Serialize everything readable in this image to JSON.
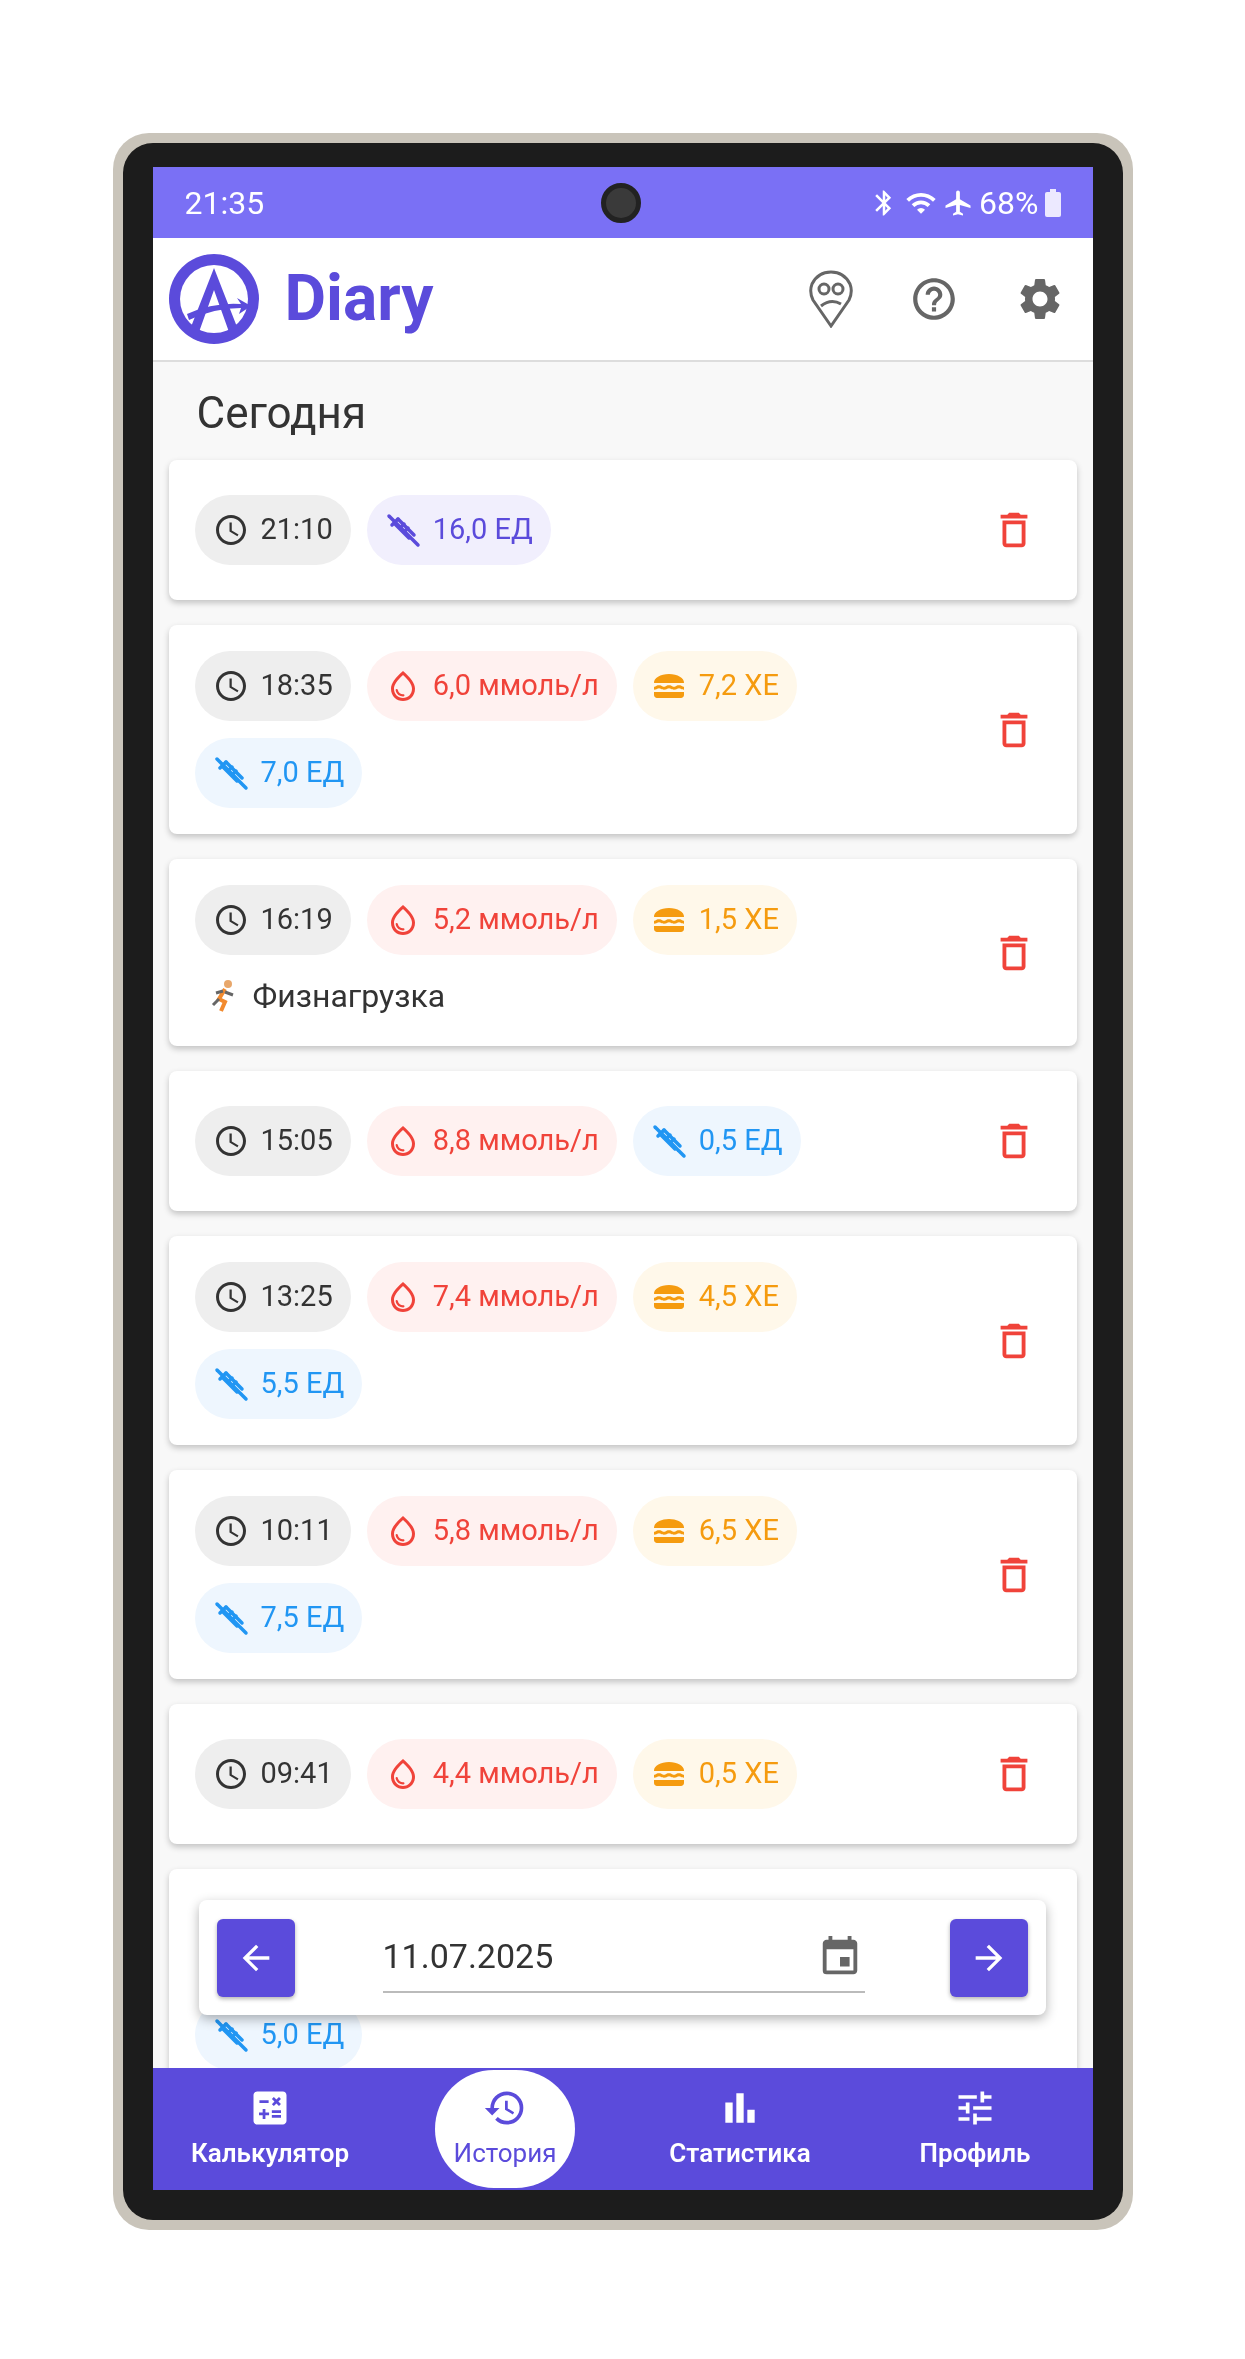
{
  "status_bar": {
    "time": "21:35",
    "battery": "68%"
  },
  "app_bar": {
    "title": "Diary"
  },
  "section_title": "Сегодня",
  "entries": [
    {
      "items": [
        {
          "kind": "time",
          "text": "21:10"
        },
        {
          "kind": "long_insulin",
          "text": "16,0 ЕД"
        }
      ]
    },
    {
      "items": [
        {
          "kind": "time",
          "text": "18:35"
        },
        {
          "kind": "glucose",
          "text": "6,0 ммоль/л"
        },
        {
          "kind": "bread",
          "text": "7,2 ХЕ"
        },
        {
          "kind": "insulin",
          "text": "7,0 ЕД"
        }
      ]
    },
    {
      "items": [
        {
          "kind": "time",
          "text": "16:19"
        },
        {
          "kind": "glucose",
          "text": "5,2 ммоль/л"
        },
        {
          "kind": "bread",
          "text": "1,5 ХЕ"
        }
      ],
      "note": "Физнагрузка"
    },
    {
      "items": [
        {
          "kind": "time",
          "text": "15:05"
        },
        {
          "kind": "glucose",
          "text": "8,8 ммоль/л"
        },
        {
          "kind": "insulin",
          "text": "0,5 ЕД"
        }
      ]
    },
    {
      "items": [
        {
          "kind": "time",
          "text": "13:25"
        },
        {
          "kind": "glucose",
          "text": "7,4 ммоль/л"
        },
        {
          "kind": "bread",
          "text": "4,5 ХЕ"
        },
        {
          "kind": "insulin",
          "text": "5,5 ЕД"
        }
      ]
    },
    {
      "items": [
        {
          "kind": "time",
          "text": "10:11"
        },
        {
          "kind": "glucose",
          "text": "5,8 ммоль/л"
        },
        {
          "kind": "bread",
          "text": "6,5 ХЕ"
        },
        {
          "kind": "insulin",
          "text": "7,5 ЕД"
        }
      ]
    },
    {
      "items": [
        {
          "kind": "time",
          "text": "09:41"
        },
        {
          "kind": "glucose",
          "text": "4,4 ммоль/л"
        },
        {
          "kind": "bread",
          "text": "0,5 ХЕ"
        }
      ]
    },
    {
      "items": [
        {
          "kind": "insulin",
          "text": "5,0 ЕД"
        }
      ],
      "covered": true
    }
  ],
  "date_bar": {
    "date": "11.07.2025"
  },
  "nav": [
    {
      "label": "Калькулятор",
      "selected": false
    },
    {
      "label": "История",
      "selected": true
    },
    {
      "label": "Статистика",
      "selected": false
    },
    {
      "label": "Профиль",
      "selected": false
    }
  ]
}
